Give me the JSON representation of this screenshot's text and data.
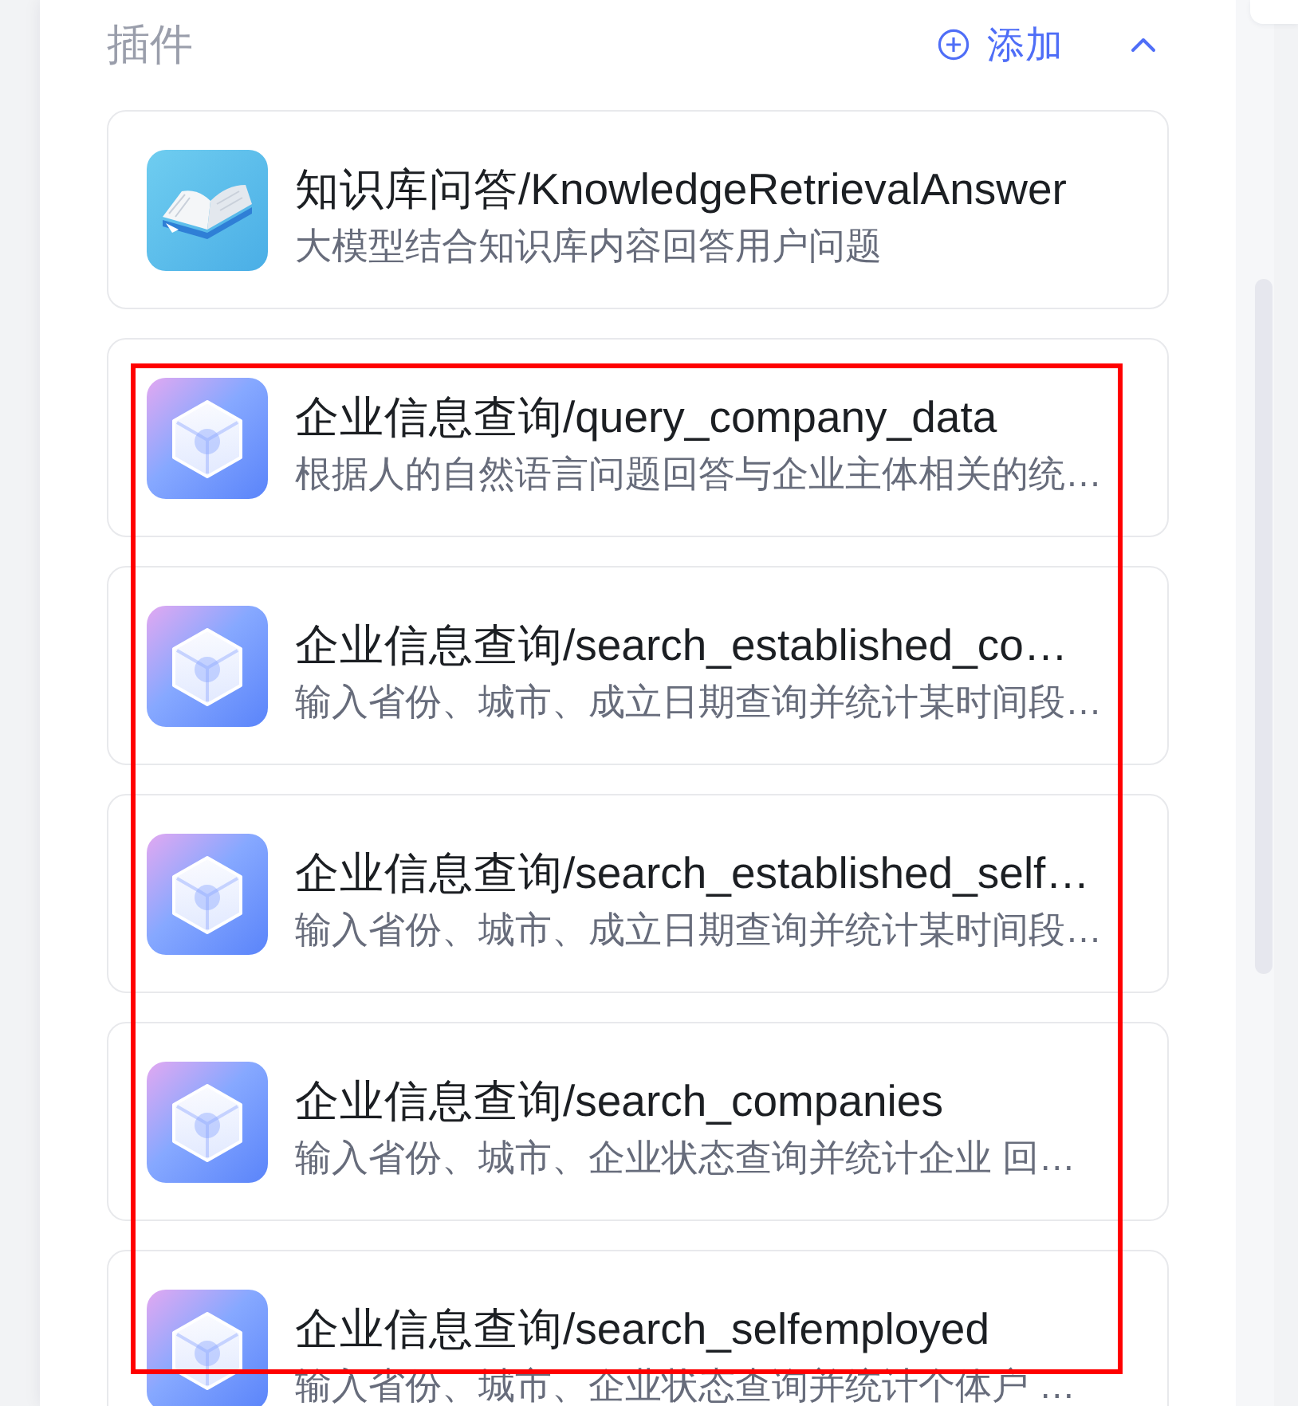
{
  "section": {
    "title": "插件",
    "add_label": "添加",
    "expanded": true
  },
  "plugins": [
    {
      "kind": "knowledge",
      "title": "知识库问答/KnowledgeRetrievalAnswer",
      "description": "大模型结合知识库内容回答用户问题",
      "highlighted": false
    },
    {
      "kind": "tool",
      "title": "企业信息查询/query_company_data",
      "description": "根据人的自然语言问题回答与企业主体相关的统…",
      "highlighted": true
    },
    {
      "kind": "tool",
      "title": "企业信息查询/search_established_co…",
      "description": "输入省份、城市、成立日期查询并统计某时间段…",
      "highlighted": true
    },
    {
      "kind": "tool",
      "title": "企业信息查询/search_established_self…",
      "description": "输入省份、城市、成立日期查询并统计某时间段…",
      "highlighted": true
    },
    {
      "kind": "tool",
      "title": "企业信息查询/search_companies",
      "description": "输入省份、城市、企业状态查询并统计企业 回…",
      "highlighted": true
    },
    {
      "kind": "tool",
      "title": "企业信息查询/search_selfemployed",
      "description": "输入省份、城市、企业状态查询并统计个体户 …",
      "highlighted": true
    }
  ]
}
